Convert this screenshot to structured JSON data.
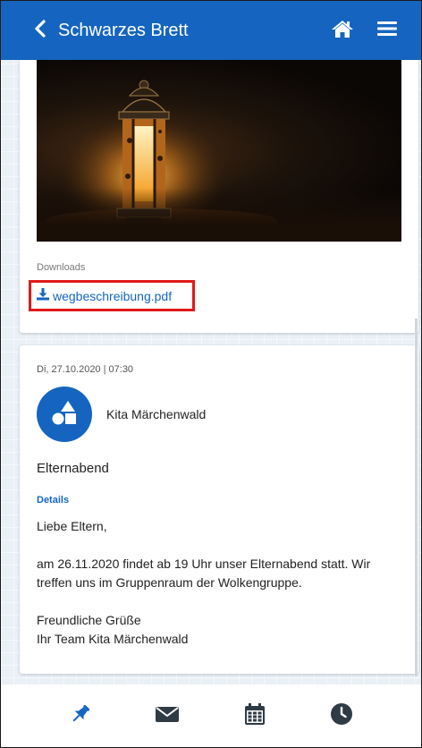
{
  "header": {
    "title": "Schwarzes Brett"
  },
  "card1": {
    "downloads_label": "Downloads",
    "download_file": "wegbeschreibung.pdf"
  },
  "post": {
    "date": "Di, 27.10.2020 | 07:30",
    "author": "Kita Märchenwald",
    "title": "Elternabend",
    "details_label": "Details",
    "paragraphs": {
      "p1": "Liebe Eltern,",
      "p2": "am 26.11.2020 findet ab 19 Uhr unser Elternabend statt. Wir treffen uns im Gruppenraum der Wolkengruppe.",
      "p3_line1": "Freundliche Grüße",
      "p3_line2": "Ihr Team Kita Märchenwald"
    }
  },
  "icons": {
    "back": "chevron-left-icon",
    "home": "home-icon",
    "menu": "hamburger-menu-icon",
    "download": "download-icon",
    "pin": "pin-icon",
    "mail": "envelope-icon",
    "calendar": "calendar-icon",
    "clock": "clock-icon"
  },
  "colors": {
    "primary": "#1565c0",
    "highlight_border": "#e0191a",
    "nav_active": "#1565c0",
    "nav_inactive": "#2f3b45"
  }
}
